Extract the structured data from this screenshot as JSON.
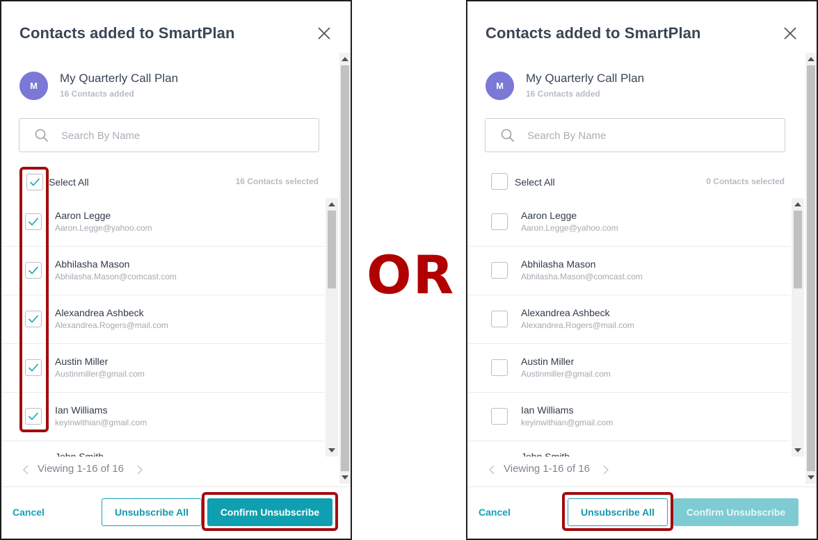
{
  "dialog": {
    "title": "Contacts added to SmartPlan",
    "plan_initial": "M",
    "plan_name": "My Quarterly Call Plan",
    "plan_count": "16 Contacts added",
    "search_placeholder": "Search By Name",
    "select_all_label": "Select All",
    "pager_text": "Viewing 1-16 of 16",
    "cancel_label": "Cancel",
    "unsubscribe_all_label": "Unsubscribe All",
    "confirm_label": "Confirm Unsubscribe"
  },
  "left_panel": {
    "selected_count": "16 Contacts selected",
    "all_checked": true,
    "confirm_enabled": true
  },
  "right_panel": {
    "selected_count": "0 Contacts selected",
    "all_checked": false,
    "confirm_enabled": false
  },
  "contacts": [
    {
      "name": "Aaron Legge",
      "email": "Aaron.Legge@yahoo.com"
    },
    {
      "name": "Abhilasha Mason",
      "email": "Abhilasha.Mason@comcast.com"
    },
    {
      "name": "Alexandrea Ashbeck",
      "email": "Alexandrea.Rogers@mail.com"
    },
    {
      "name": "Austin Miller",
      "email": "Austinmiller@gmail.com"
    },
    {
      "name": "Ian Williams",
      "email": "keyinwithian@gmail.com"
    },
    {
      "name": "John Smith",
      "email": ""
    }
  ],
  "separator": "OR",
  "colors": {
    "accent": "#17a2b8",
    "highlight": "#a10d0d",
    "avatar": "#7b78d6"
  }
}
